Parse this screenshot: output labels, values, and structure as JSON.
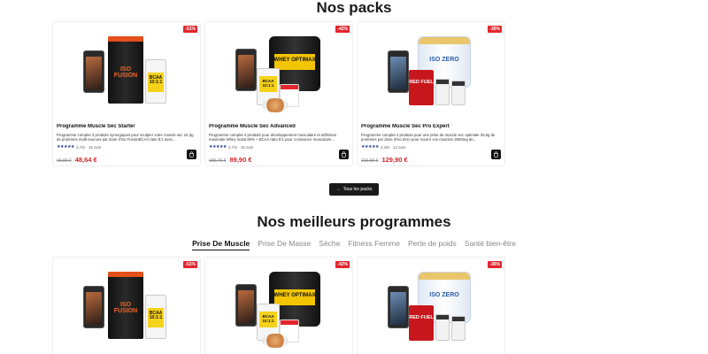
{
  "packs": {
    "title": "Nos packs",
    "all_button": "Tous les packs",
    "products": [
      {
        "badge": "-51%",
        "name": "Programme Muscle Sec Starter",
        "description": "Programme complet 3 produits synergiques pour sculpter votre muscle sec 24,3g de protéines multi-sources par dose d'Iso FusionBCAA ratio 8:1 avec...",
        "rating": "4,7/5 · 15 avis",
        "old_price": "99,80 €",
        "price": "48,64 €",
        "image": {
          "tub_label": "ISO FUSION",
          "bottle_label": "BCAA 10:1:1"
        }
      },
      {
        "badge": "-42%",
        "name": "Programme Muscle Sec Advanced",
        "description": "Programme complet 4 produits pour développement musculaire et définition maximale Whey Isolat 90% + BCAA ratio 8:1 pour croissance musculaire...",
        "rating": "4,7/5 · 15 avis",
        "old_price": "155,70 €",
        "price": "89,90 €",
        "image": {
          "tub_label": "WHEY OPTIMAX",
          "bottle_label": "BCAA 10:1:1"
        }
      },
      {
        "badge": "-36%",
        "name": "Programme Muscle Sec Pro Expert",
        "description": "Programme complet 4 produits pour une prise de muscle sec optimale 25,5g de protéines par dose d'Iso Zero pour nourrir vos muscles 3000mg de...",
        "rating": "4,4/5 · 13 avis",
        "old_price": "216,60 €",
        "price": "129,90 €",
        "image": {
          "tub_label": "ISO ZERO",
          "bottle_label": "RED FUEL"
        }
      }
    ]
  },
  "programs": {
    "title": "Nos meilleurs programmes",
    "tabs": [
      "Prise De Muscle",
      "Prise De Masse",
      "Sèche",
      "Fitness Femme",
      "Perte de poids",
      "Santé bien-être"
    ],
    "active_tab": "Prise De Muscle",
    "products": [
      {
        "badge": "-51%"
      },
      {
        "badge": "-42%"
      },
      {
        "badge": "-36%"
      }
    ]
  },
  "colors": {
    "accent": "#d4252b",
    "dark": "#1a1a1a",
    "stars": "#1e3a8a"
  }
}
